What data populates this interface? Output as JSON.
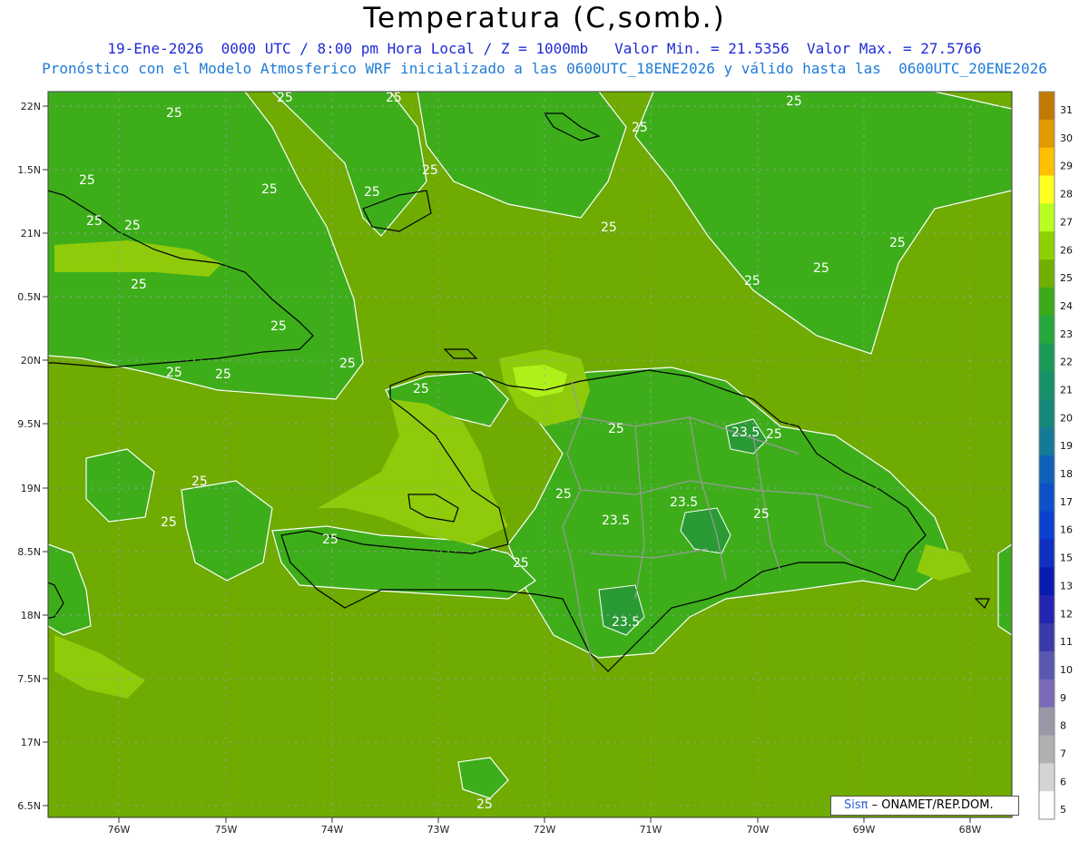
{
  "title": "Temperatura (C,somb.)",
  "subtitle_line1": "19-Ene-2026  0000 UTC / 8:00 pm Hora Local / Z = 1000mb   Valor Min. = 21.5356  Valor Max. = 27.5766",
  "subtitle_line2": "Pronóstico con el Modelo Atmosferico WRF inicializado a las 0600UTC_18ENE2026 y válido hasta las  0600UTC_20ENE2026",
  "lat_ticks": [
    "22N",
    "1.5N",
    "21N",
    "0.5N",
    "20N",
    "9.5N",
    "19N",
    "8.5N",
    "18N",
    "7.5N",
    "17N",
    "6.5N"
  ],
  "lon_ticks": [
    "76W",
    "75W",
    "74W",
    "73W",
    "72W",
    "71W",
    "70W",
    "69W",
    "68W"
  ],
  "colorbar": {
    "labels": [
      "31",
      "30",
      "29",
      "28",
      "27",
      "26",
      "25",
      "24",
      "23",
      "22",
      "21",
      "20",
      "19",
      "18",
      "17",
      "16",
      "15",
      "13",
      "12",
      "11",
      "10",
      "9",
      "8",
      "7",
      "6",
      "5"
    ],
    "colors": [
      "#c07a00",
      "#e09a00",
      "#ffc000",
      "#ffff20",
      "#b8ff20",
      "#8fd000",
      "#6fb000",
      "#3daa1a",
      "#26a83c",
      "#1a9a55",
      "#18906a",
      "#168878",
      "#147a96",
      "#1062b8",
      "#0e50c8",
      "#0c40d0",
      "#1030c0",
      "#0a1cb0",
      "#2424b0",
      "#3a3aa8",
      "#5858b0",
      "#7a6ab8",
      "#9898a8",
      "#b0b0b0",
      "#d4d4d4",
      "#ffffff"
    ]
  },
  "contour_labels": [
    "25",
    "25",
    "25",
    "25",
    "25",
    "25",
    "25",
    "25",
    "25",
    "25",
    "25",
    "25",
    "25",
    "25",
    "25",
    "25",
    "25",
    "25",
    "25",
    "25",
    "25",
    "25",
    "25",
    "25",
    "25",
    "25",
    "25",
    "23.5",
    "23.5",
    "23.5",
    "23.5",
    "25",
    "25",
    "25"
  ],
  "colors": {
    "background_field": "#6fab00",
    "field_24": "#3dae1a",
    "field_23": "#2a9a35",
    "field_26": "#8fcb0a",
    "field_27": "#aef01a",
    "coast": "#000000",
    "provinces": "#9a9a9a",
    "title": "#000000",
    "subtitle1": "#1f2bd6",
    "subtitle2": "#1f7bd6"
  },
  "credit": {
    "brand": "Sisπ",
    "org": "– ONAMET/REP.DOM."
  }
}
